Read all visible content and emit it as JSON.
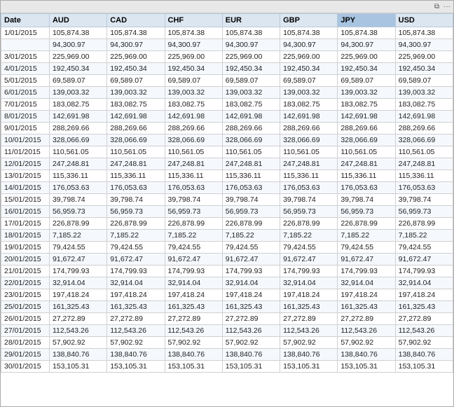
{
  "window": {
    "title": ""
  },
  "toolbar": {
    "icons": [
      "restore-icon",
      "more-icon"
    ]
  },
  "table": {
    "columns": [
      {
        "key": "date",
        "label": "Date",
        "active": false
      },
      {
        "key": "aud",
        "label": "AUD",
        "active": false
      },
      {
        "key": "cad",
        "label": "CAD",
        "active": false
      },
      {
        "key": "chf",
        "label": "CHF",
        "active": false
      },
      {
        "key": "eur",
        "label": "EUR",
        "active": false
      },
      {
        "key": "gbp",
        "label": "GBP",
        "active": false
      },
      {
        "key": "jpy",
        "label": "JPY",
        "active": true
      },
      {
        "key": "usd",
        "label": "USD",
        "active": false
      }
    ],
    "rows": [
      {
        "date": "1/01/2015",
        "aud": "105,874.38",
        "cad": "105,874.38",
        "chf": "105,874.38",
        "eur": "105,874.38",
        "gbp": "105,874.38",
        "jpy": "105,874.38",
        "usd": "105,874.38"
      },
      {
        "date": "",
        "aud": "94,300.97",
        "cad": "94,300.97",
        "chf": "94,300.97",
        "eur": "94,300.97",
        "gbp": "94,300.97",
        "jpy": "94,300.97",
        "usd": "94,300.97"
      },
      {
        "date": "3/01/2015",
        "aud": "225,969.00",
        "cad": "225,969.00",
        "chf": "225,969.00",
        "eur": "225,969.00",
        "gbp": "225,969.00",
        "jpy": "225,969.00",
        "usd": "225,969.00"
      },
      {
        "date": "4/01/2015",
        "aud": "192,450.34",
        "cad": "192,450.34",
        "chf": "192,450.34",
        "eur": "192,450.34",
        "gbp": "192,450.34",
        "jpy": "192,450.34",
        "usd": "192,450.34"
      },
      {
        "date": "5/01/2015",
        "aud": "69,589.07",
        "cad": "69,589.07",
        "chf": "69,589.07",
        "eur": "69,589.07",
        "gbp": "69,589.07",
        "jpy": "69,589.07",
        "usd": "69,589.07"
      },
      {
        "date": "6/01/2015",
        "aud": "139,003.32",
        "cad": "139,003.32",
        "chf": "139,003.32",
        "eur": "139,003.32",
        "gbp": "139,003.32",
        "jpy": "139,003.32",
        "usd": "139,003.32"
      },
      {
        "date": "7/01/2015",
        "aud": "183,082.75",
        "cad": "183,082.75",
        "chf": "183,082.75",
        "eur": "183,082.75",
        "gbp": "183,082.75",
        "jpy": "183,082.75",
        "usd": "183,082.75"
      },
      {
        "date": "8/01/2015",
        "aud": "142,691.98",
        "cad": "142,691.98",
        "chf": "142,691.98",
        "eur": "142,691.98",
        "gbp": "142,691.98",
        "jpy": "142,691.98",
        "usd": "142,691.98"
      },
      {
        "date": "9/01/2015",
        "aud": "288,269.66",
        "cad": "288,269.66",
        "chf": "288,269.66",
        "eur": "288,269.66",
        "gbp": "288,269.66",
        "jpy": "288,269.66",
        "usd": "288,269.66"
      },
      {
        "date": "10/01/2015",
        "aud": "328,066.69",
        "cad": "328,066.69",
        "chf": "328,066.69",
        "eur": "328,066.69",
        "gbp": "328,066.69",
        "jpy": "328,066.69",
        "usd": "328,066.69"
      },
      {
        "date": "11/01/2015",
        "aud": "110,561.05",
        "cad": "110,561.05",
        "chf": "110,561.05",
        "eur": "110,561.05",
        "gbp": "110,561.05",
        "jpy": "110,561.05",
        "usd": "110,561.05"
      },
      {
        "date": "12/01/2015",
        "aud": "247,248.81",
        "cad": "247,248.81",
        "chf": "247,248.81",
        "eur": "247,248.81",
        "gbp": "247,248.81",
        "jpy": "247,248.81",
        "usd": "247,248.81"
      },
      {
        "date": "13/01/2015",
        "aud": "115,336.11",
        "cad": "115,336.11",
        "chf": "115,336.11",
        "eur": "115,336.11",
        "gbp": "115,336.11",
        "jpy": "115,336.11",
        "usd": "115,336.11"
      },
      {
        "date": "14/01/2015",
        "aud": "176,053.63",
        "cad": "176,053.63",
        "chf": "176,053.63",
        "eur": "176,053.63",
        "gbp": "176,053.63",
        "jpy": "176,053.63",
        "usd": "176,053.63"
      },
      {
        "date": "15/01/2015",
        "aud": "39,798.74",
        "cad": "39,798.74",
        "chf": "39,798.74",
        "eur": "39,798.74",
        "gbp": "39,798.74",
        "jpy": "39,798.74",
        "usd": "39,798.74"
      },
      {
        "date": "16/01/2015",
        "aud": "56,959.73",
        "cad": "56,959.73",
        "chf": "56,959.73",
        "eur": "56,959.73",
        "gbp": "56,959.73",
        "jpy": "56,959.73",
        "usd": "56,959.73"
      },
      {
        "date": "17/01/2015",
        "aud": "226,878.99",
        "cad": "226,878.99",
        "chf": "226,878.99",
        "eur": "226,878.99",
        "gbp": "226,878.99",
        "jpy": "226,878.99",
        "usd": "226,878.99"
      },
      {
        "date": "18/01/2015",
        "aud": "7,185.22",
        "cad": "7,185.22",
        "chf": "7,185.22",
        "eur": "7,185.22",
        "gbp": "7,185.22",
        "jpy": "7,185.22",
        "usd": "7,185.22"
      },
      {
        "date": "19/01/2015",
        "aud": "79,424.55",
        "cad": "79,424.55",
        "chf": "79,424.55",
        "eur": "79,424.55",
        "gbp": "79,424.55",
        "jpy": "79,424.55",
        "usd": "79,424.55"
      },
      {
        "date": "20/01/2015",
        "aud": "91,672.47",
        "cad": "91,672.47",
        "chf": "91,672.47",
        "eur": "91,672.47",
        "gbp": "91,672.47",
        "jpy": "91,672.47",
        "usd": "91,672.47"
      },
      {
        "date": "21/01/2015",
        "aud": "174,799.93",
        "cad": "174,799.93",
        "chf": "174,799.93",
        "eur": "174,799.93",
        "gbp": "174,799.93",
        "jpy": "174,799.93",
        "usd": "174,799.93"
      },
      {
        "date": "22/01/2015",
        "aud": "32,914.04",
        "cad": "32,914.04",
        "chf": "32,914.04",
        "eur": "32,914.04",
        "gbp": "32,914.04",
        "jpy": "32,914.04",
        "usd": "32,914.04"
      },
      {
        "date": "23/01/2015",
        "aud": "197,418.24",
        "cad": "197,418.24",
        "chf": "197,418.24",
        "eur": "197,418.24",
        "gbp": "197,418.24",
        "jpy": "197,418.24",
        "usd": "197,418.24"
      },
      {
        "date": "25/01/2015",
        "aud": "161,325.43",
        "cad": "161,325.43",
        "chf": "161,325.43",
        "eur": "161,325.43",
        "gbp": "161,325.43",
        "jpy": "161,325.43",
        "usd": "161,325.43"
      },
      {
        "date": "26/01/2015",
        "aud": "27,272.89",
        "cad": "27,272.89",
        "chf": "27,272.89",
        "eur": "27,272.89",
        "gbp": "27,272.89",
        "jpy": "27,272.89",
        "usd": "27,272.89"
      },
      {
        "date": "27/01/2015",
        "aud": "112,543.26",
        "cad": "112,543.26",
        "chf": "112,543.26",
        "eur": "112,543.26",
        "gbp": "112,543.26",
        "jpy": "112,543.26",
        "usd": "112,543.26"
      },
      {
        "date": "28/01/2015",
        "aud": "57,902.92",
        "cad": "57,902.92",
        "chf": "57,902.92",
        "eur": "57,902.92",
        "gbp": "57,902.92",
        "jpy": "57,902.92",
        "usd": "57,902.92"
      },
      {
        "date": "29/01/2015",
        "aud": "138,840.76",
        "cad": "138,840.76",
        "chf": "138,840.76",
        "eur": "138,840.76",
        "gbp": "138,840.76",
        "jpy": "138,840.76",
        "usd": "138,840.76"
      },
      {
        "date": "30/01/2015",
        "aud": "153,105.31",
        "cad": "153,105.31",
        "chf": "153,105.31",
        "eur": "153,105.31",
        "gbp": "153,105.31",
        "jpy": "153,105.31",
        "usd": "153,105.31"
      }
    ]
  }
}
